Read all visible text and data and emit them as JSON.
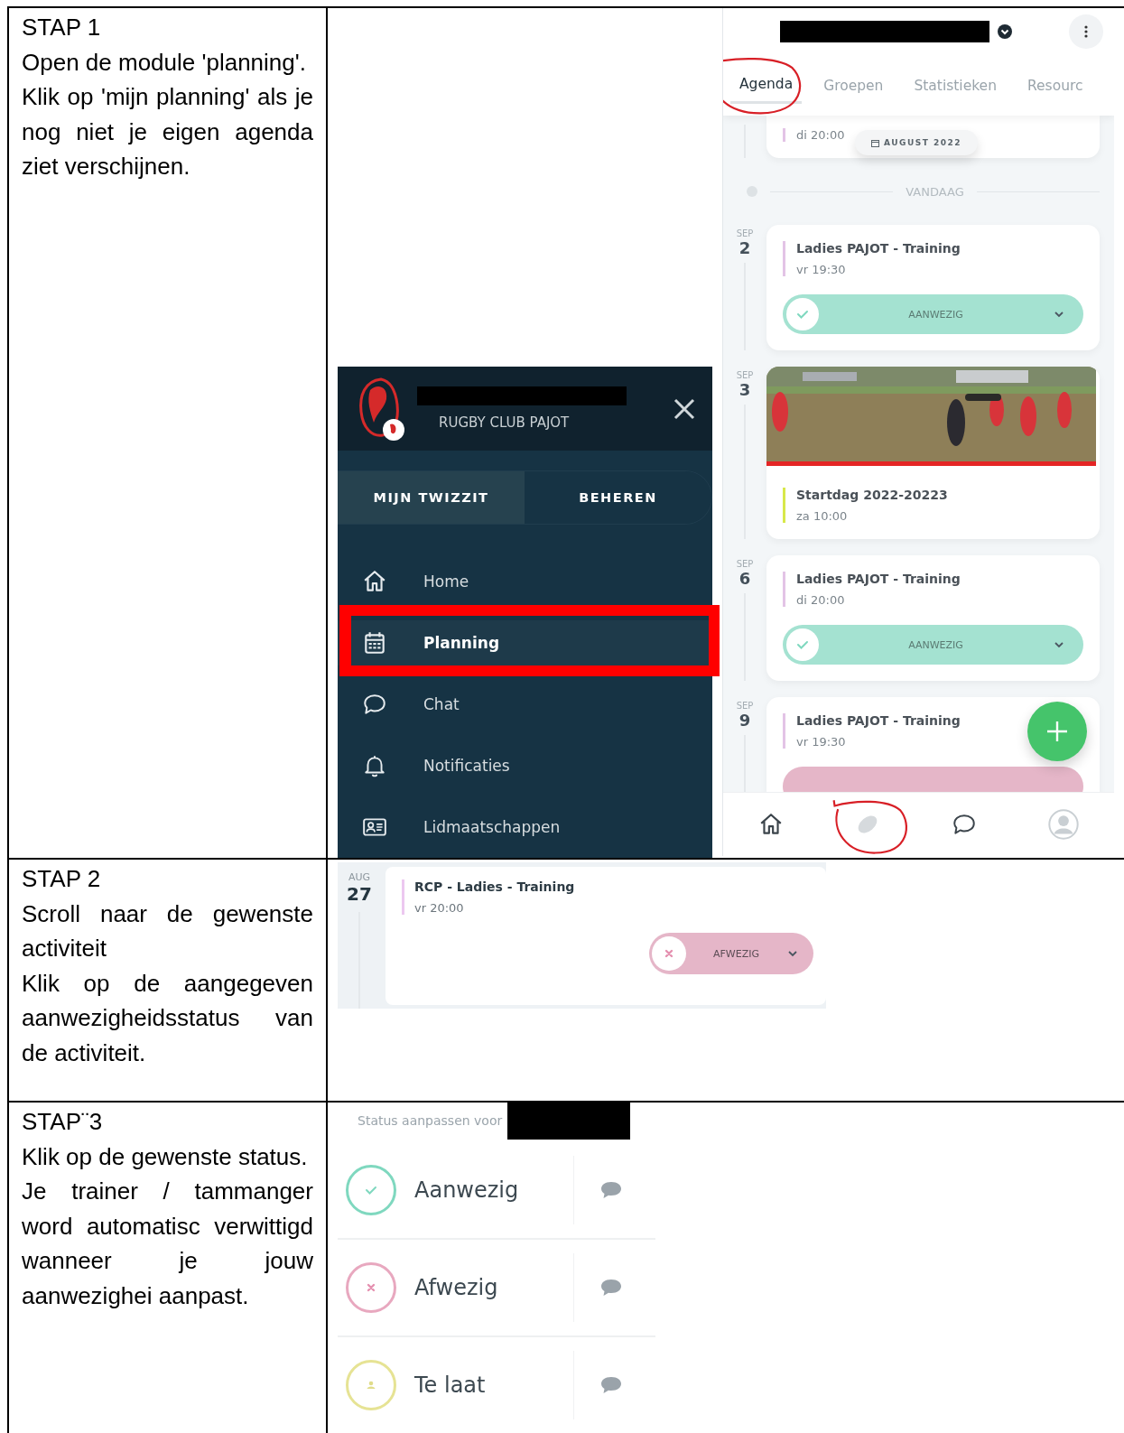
{
  "steps": [
    {
      "title": "STAP 1",
      "paragraphs": [
        "Open de module 'planning'.",
        "Klik op 'mijn planning' als je nog niet je eigen agenda ziet verschijnen."
      ]
    },
    {
      "title": "STAP 2",
      "paragraphs": [
        "Scroll naar de gewenste activiteit",
        "Klik op de aangegeven aanwezigheidsstatus van de activiteit."
      ]
    },
    {
      "title": "STAP¨3",
      "paragraphs": [
        "Klik op de gewenste status.",
        "Je trainer / tammanger word automatisc verwittigd wanneer je jouw aanwezighei aanpast."
      ]
    }
  ],
  "menu": {
    "club": "RUGBY CLUB PAJOT",
    "tabs": [
      {
        "label": "MIJN TWIZZIT",
        "selected": true
      },
      {
        "label": "BEHEREN",
        "selected": false
      }
    ],
    "items": [
      {
        "label": "Home",
        "kind": "home",
        "selected": false,
        "annotated": false
      },
      {
        "label": "Planning",
        "kind": "calendar",
        "selected": true,
        "annotated": true
      },
      {
        "label": "Chat",
        "kind": "chat",
        "selected": false,
        "annotated": false
      },
      {
        "label": "Notificaties",
        "kind": "bell",
        "selected": false,
        "annotated": false
      },
      {
        "label": "Lidmaatschappen",
        "kind": "card",
        "selected": false,
        "annotated": false
      }
    ]
  },
  "agenda": {
    "tabs": [
      {
        "label": "Agenda",
        "selected": true,
        "annotated": true
      },
      {
        "label": "Groepen",
        "selected": false,
        "annotated": false
      },
      {
        "label": "Statistieken",
        "selected": false,
        "annotated": false
      },
      {
        "label": "Resourc",
        "selected": false,
        "annotated": false
      }
    ],
    "partial_event": {
      "time": "di 20:00",
      "color": "#e3c4e6"
    },
    "month_badge": "AUGUST 2022",
    "today_label": "VANDAAG",
    "events": [
      {
        "month": "SEP",
        "day": "2",
        "kind": "plain",
        "title": "Ladies PAJOT - Training",
        "time": "vr 19:30",
        "color": "#e3c4e6",
        "status": {
          "kind": "present",
          "label": "AANWEZIG"
        }
      },
      {
        "month": "SEP",
        "day": "3",
        "title": "Startdag 2022-20223",
        "time": "za 10:00",
        "color": "#d8e84a"
      },
      {
        "month": "SEP",
        "day": "6",
        "kind": "plain",
        "title": "Ladies PAJOT - Training",
        "time": "di 20:00",
        "color": "#e3c4e6",
        "status": {
          "kind": "present",
          "label": "AANWEZIG"
        }
      },
      {
        "month": "SEP",
        "day": "9",
        "kind": "plain",
        "title": "Ladies PAJOT - Training",
        "time": "vr 19:30",
        "color": "#e3c4e6",
        "status": {
          "kind": "absent"
        }
      }
    ],
    "nav": [
      {
        "kind": "home",
        "annotated": false
      },
      {
        "kind": "ball",
        "annotated": true
      },
      {
        "kind": "chat",
        "annotated": false
      },
      {
        "kind": "profile",
        "annotated": false
      }
    ]
  },
  "activity": {
    "month": "AUG",
    "day": "27",
    "title": "RCP - Ladies - Training",
    "time": "vr 20:00",
    "color": "#ecc8f0",
    "status": {
      "kind": "absent",
      "label": "AFWEZIG"
    }
  },
  "status_sheet": {
    "heading": "Status aanpassen voor",
    "options": [
      {
        "label": "Aanwezig",
        "kind": "present"
      },
      {
        "label": "Afwezig",
        "kind": "absent"
      },
      {
        "label": "Te laat",
        "kind": "late"
      }
    ]
  }
}
